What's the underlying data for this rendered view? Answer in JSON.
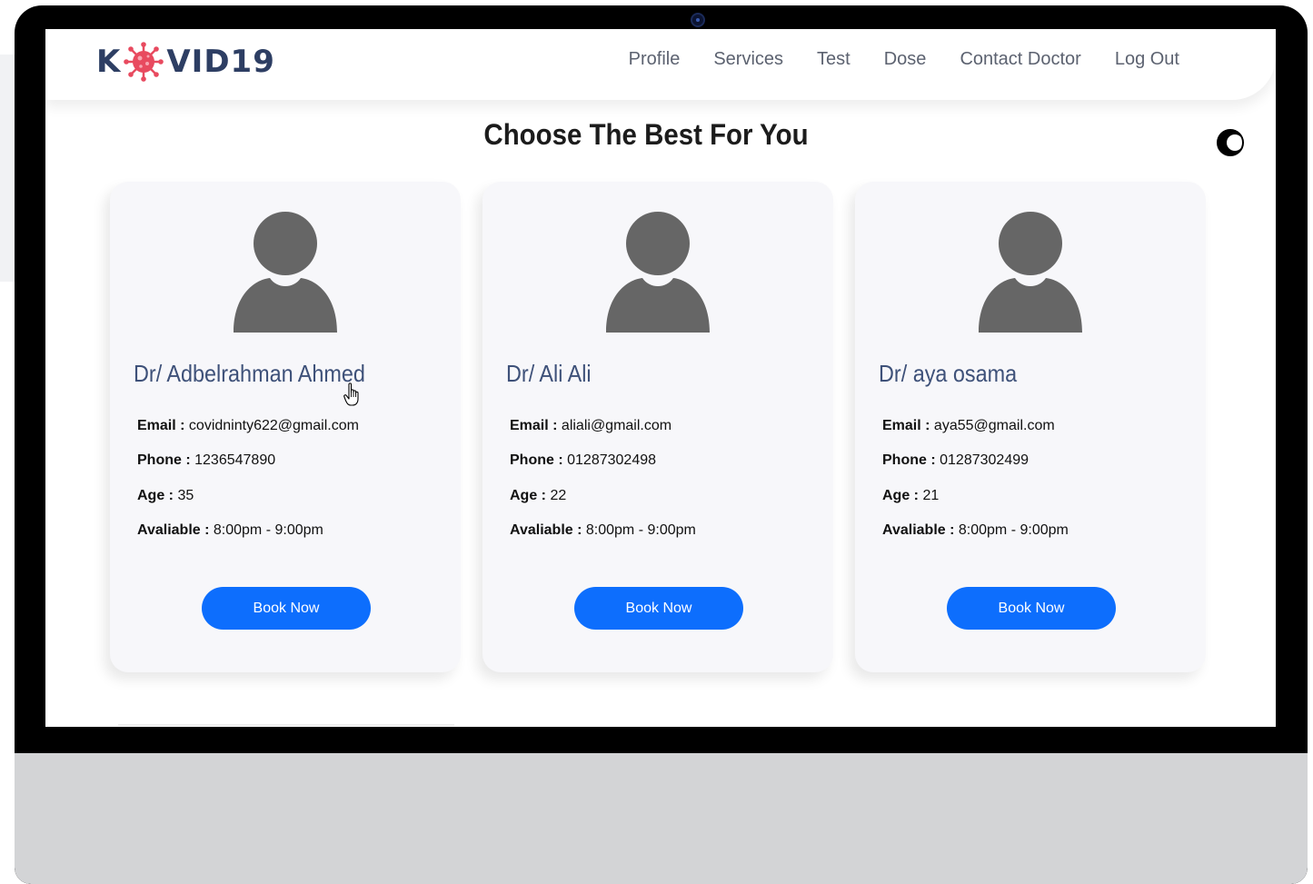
{
  "brand": {
    "left": "K",
    "right": "VID19",
    "accent_color": "#e84a5f",
    "text_color": "#2d3e63"
  },
  "nav": {
    "items": [
      "Profile",
      "Services",
      "Test",
      "Dose",
      "Contact Doctor",
      "Log Out"
    ]
  },
  "page": {
    "title": "Choose The Best For You",
    "theme_toggle_icon": "moon-icon"
  },
  "labels": {
    "email": "Email :",
    "phone": "Phone :",
    "age": "Age :",
    "available": "Avaliable :"
  },
  "doctors": [
    {
      "name": "Dr/ Adbelrahman Ahmed",
      "email": "covidninty622@gmail.com",
      "phone": "1236547890",
      "age": "35",
      "available": "8:00pm - 9:00pm",
      "button": "Book Now"
    },
    {
      "name": "Dr/ Ali Ali",
      "email": "aliali@gmail.com",
      "phone": "01287302498",
      "age": "22",
      "available": "8:00pm - 9:00pm",
      "button": "Book Now"
    },
    {
      "name": "Dr/ aya osama",
      "email": "aya55@gmail.com",
      "phone": "01287302499",
      "age": "21",
      "available": "8:00pm - 9:00pm",
      "button": "Book Now"
    }
  ],
  "colors": {
    "primary_button": "#0d6efd",
    "card_bg": "#f7f7fa",
    "doctor_name": "#3e5179"
  }
}
